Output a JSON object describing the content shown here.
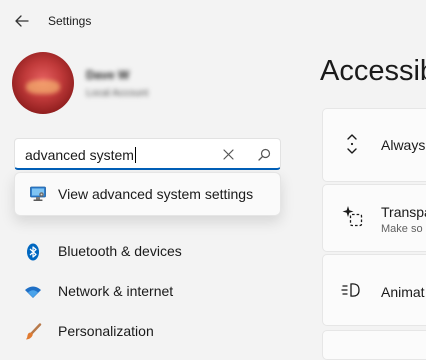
{
  "window": {
    "title": "Settings"
  },
  "user": {
    "name": "Dave W",
    "account_type": "Local Account"
  },
  "search": {
    "value": "advanced system",
    "suggestion": "View advanced system settings"
  },
  "nav": {
    "items": [
      {
        "label": "Bluetooth & devices"
      },
      {
        "label": "Network & internet"
      },
      {
        "label": "Personalization"
      }
    ]
  },
  "main": {
    "heading": "Accessib",
    "cards": [
      {
        "title": "Always",
        "subtitle": ""
      },
      {
        "title": "Transpa",
        "subtitle": "Make so"
      },
      {
        "title": "Animat",
        "subtitle": ""
      }
    ]
  },
  "colors": {
    "accent": "#005fb8",
    "bluetooth": "#0067c0",
    "background": "#f3f3f3"
  }
}
